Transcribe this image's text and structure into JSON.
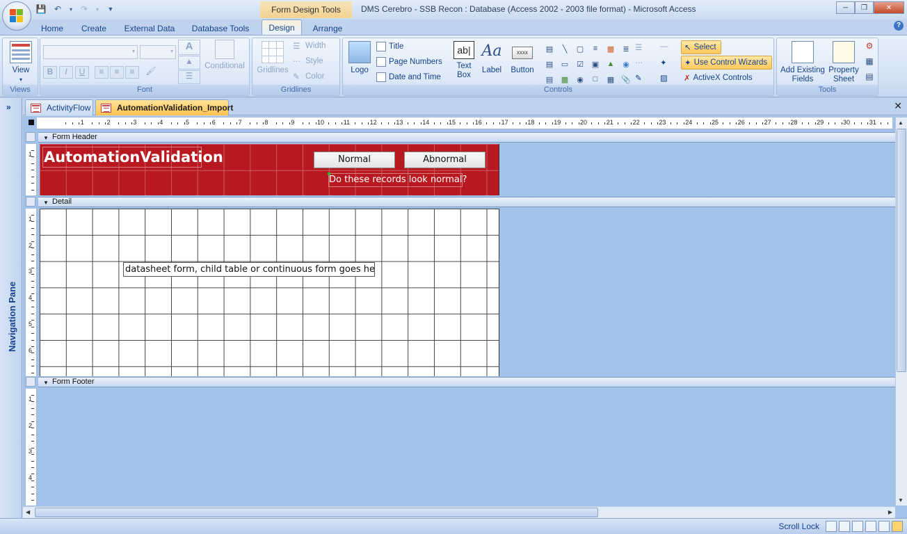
{
  "titlebar": {
    "context_group": "Form Design Tools",
    "window_title": "DMS Cerebro - SSB Recon : Database (Access 2002 - 2003 file format) - Microsoft Access"
  },
  "ribbon_tabs": [
    "Home",
    "Create",
    "External Data",
    "Database Tools",
    "Design",
    "Arrange"
  ],
  "active_ribbon_tab": "Design",
  "ribbon": {
    "views": {
      "view_label": "View",
      "group_label": "Views"
    },
    "font": {
      "conditional_label": "Conditional",
      "group_label": "Font"
    },
    "gridlines": {
      "gridlines_label": "Gridlines",
      "width_label": "Width",
      "style_label": "Style",
      "color_label": "Color",
      "group_label": "Gridlines"
    },
    "controls": {
      "logo_label": "Logo",
      "title_label": "Title",
      "page_numbers_label": "Page Numbers",
      "date_time_label": "Date and Time",
      "textbox_label": "Text Box",
      "label_label": "Label",
      "button_label": "Button",
      "button_sample": "xxxx",
      "select_label": "Select",
      "wizards_label": "Use Control Wizards",
      "activex_label": "ActiveX Controls",
      "group_label": "Controls"
    },
    "tools": {
      "add_fields_label": "Add Existing Fields",
      "property_sheet_label": "Property Sheet",
      "group_label": "Tools"
    }
  },
  "navigation_pane": {
    "label": "Navigation Pane"
  },
  "document_tabs": [
    {
      "label": "ActivityFlow",
      "active": false
    },
    {
      "label": "AutomationValidation_Import",
      "active": true
    }
  ],
  "form": {
    "sections": {
      "header": "Form Header",
      "detail": "Detail",
      "footer": "Form Footer"
    },
    "title_label": "AutomationValidation",
    "normal_button": "Normal",
    "abnormal_button": "Abnormal",
    "question_label": "Do these records look normal?",
    "detail_placeholder": "datasheet form, child table or continuous form goes here.",
    "header_color": "#b81820"
  },
  "ruler": {
    "horizontal_numbers": [
      "1",
      "2",
      "3",
      "4",
      "5",
      "6",
      "7",
      "8",
      "9",
      "10",
      "11",
      "12",
      "13",
      "14",
      "15",
      "16",
      "17",
      "18",
      "19",
      "20",
      "21",
      "22",
      "23",
      "24",
      "25",
      "26",
      "27",
      "28",
      "29",
      "30",
      "31",
      "32"
    ],
    "header_numbers": [
      "1"
    ],
    "detail_numbers": [
      "1",
      "2",
      "3",
      "4",
      "5",
      "6"
    ],
    "footer_numbers": [
      "1",
      "2",
      "3",
      "4"
    ]
  },
  "statusbar": {
    "scroll_lock": "Scroll Lock"
  },
  "colors": {
    "accent": "#ffc34e",
    "ribbon_text": "#15428b",
    "canvas_bg": "#a3c2e9"
  }
}
